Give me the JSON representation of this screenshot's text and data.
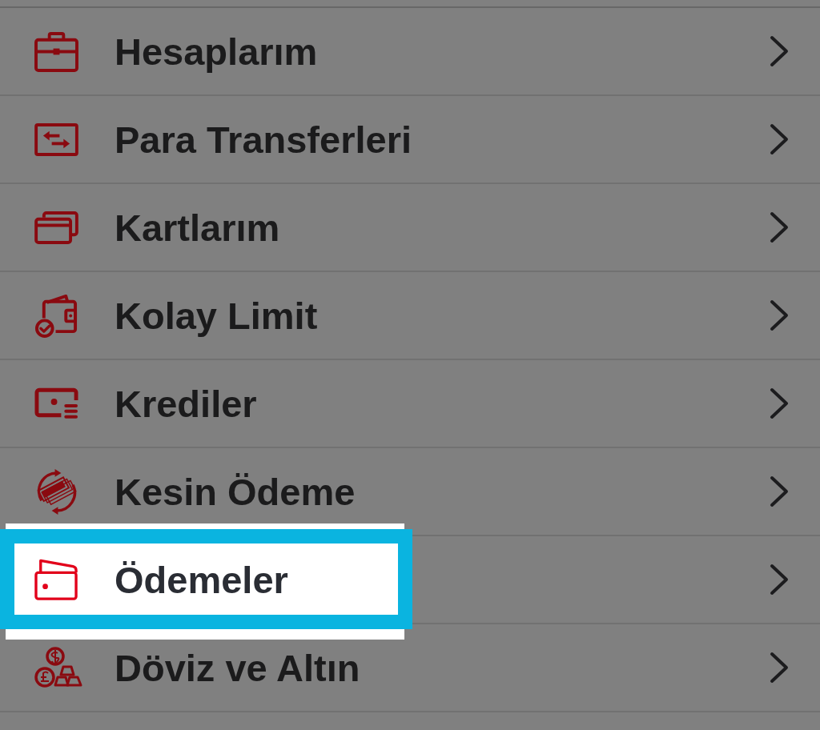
{
  "menu": {
    "items": [
      {
        "label": "Hesaplarım",
        "highlighted": false
      },
      {
        "label": "Para Transferleri",
        "highlighted": false
      },
      {
        "label": "Kartlarım",
        "highlighted": false
      },
      {
        "label": "Kolay Limit",
        "highlighted": false
      },
      {
        "label": "Krediler",
        "highlighted": false
      },
      {
        "label": "Kesin Ödeme",
        "highlighted": false
      },
      {
        "label": "Ödemeler",
        "highlighted": true
      },
      {
        "label": "Döviz ve Altın",
        "highlighted": false
      }
    ]
  }
}
